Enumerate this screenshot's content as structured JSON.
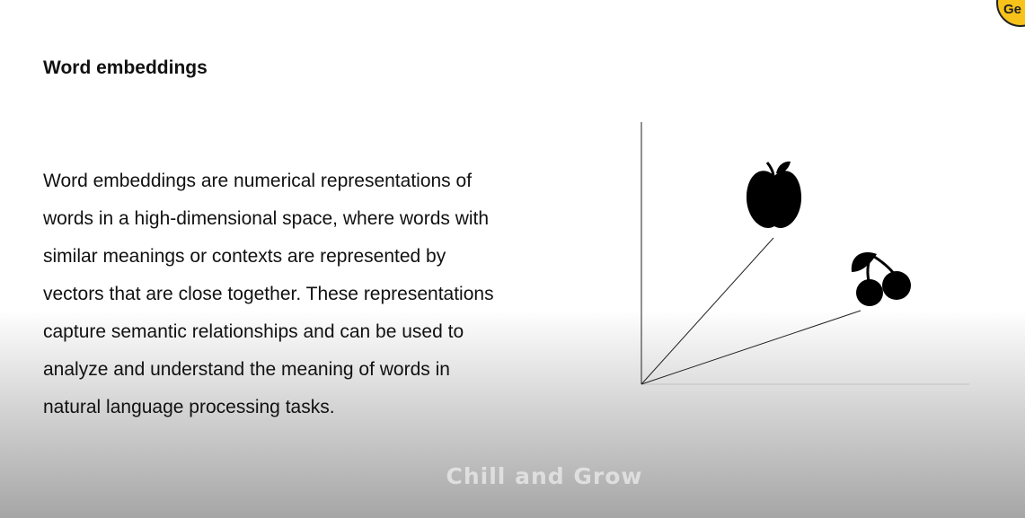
{
  "slide": {
    "title": "Word embeddings",
    "body_lines": [
      "Word embeddings are numerical representations of",
      "words in a high-dimensional space, where words with",
      "similar meanings or contexts are represented by",
      "vectors that are close together. These representations",
      "capture semantic relationships and can be used to",
      "analyze and understand the meaning of words in",
      "natural language processing tasks."
    ]
  },
  "diagram": {
    "icons": [
      "apple-icon",
      "cherry-icon"
    ]
  },
  "watermark": {
    "text": "Chill and Grow"
  },
  "logo": {
    "text": "Ge",
    "color": "#f7c21a"
  }
}
